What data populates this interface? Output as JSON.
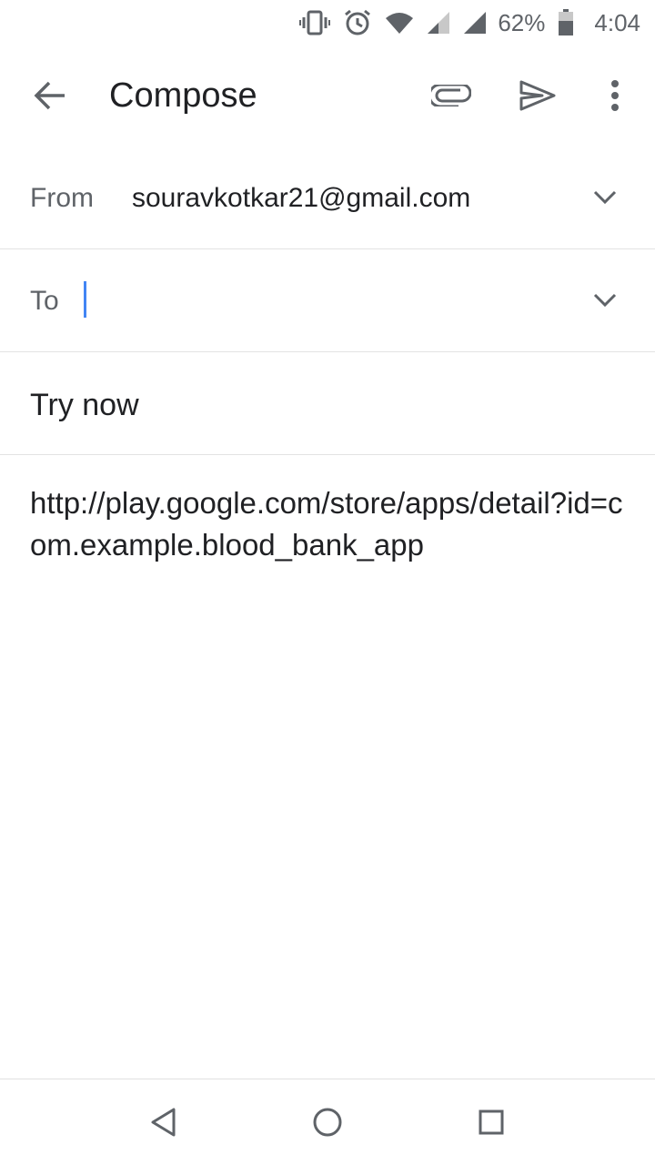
{
  "status_bar": {
    "battery_percent": "62%",
    "time": "4:04",
    "icons": [
      "vibrate-icon",
      "alarm-icon",
      "wifi-icon",
      "signal-icon",
      "signal-icon",
      "battery-icon"
    ]
  },
  "app_bar": {
    "title": "Compose",
    "actions": [
      "back-arrow-icon",
      "attachment-icon",
      "send-icon",
      "more-vert-icon"
    ]
  },
  "from": {
    "label": "From",
    "value": "souravkotkar21@gmail.com"
  },
  "to": {
    "label": "To",
    "value": ""
  },
  "subject": {
    "value": "Try now"
  },
  "body": {
    "text": "http://play.google.com/store/apps/detail?id=com.example.blood_bank_app"
  },
  "colors": {
    "accent_caret": "#4285f4",
    "icon_gray": "#5f6368",
    "text_primary": "#202124"
  },
  "nav_bar": {
    "buttons": [
      "nav-back-icon",
      "nav-home-icon",
      "nav-recents-icon"
    ]
  }
}
